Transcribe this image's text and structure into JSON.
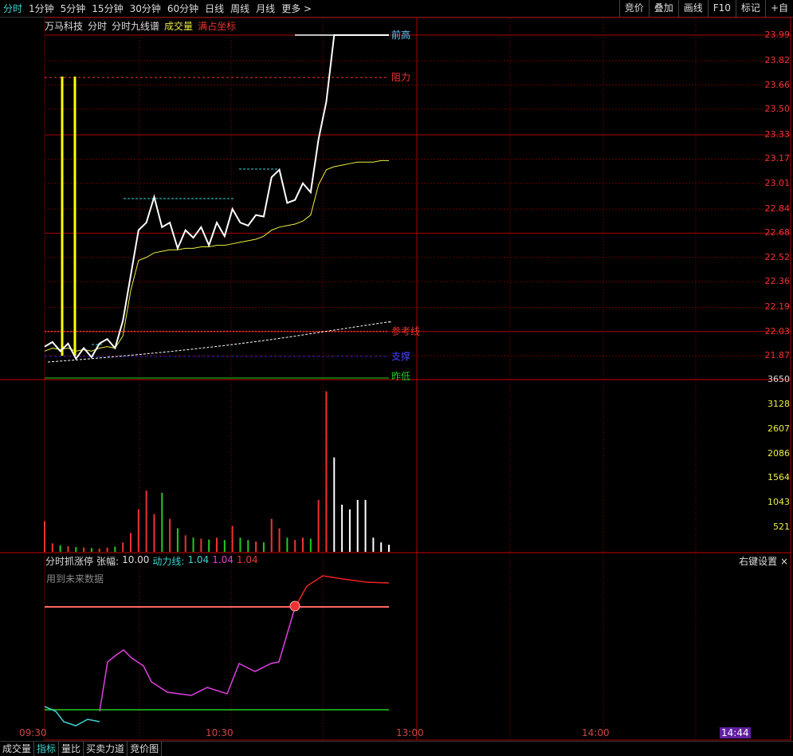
{
  "top_tabs": [
    "分时",
    "1分钟",
    "5分钟",
    "15分钟",
    "30分钟",
    "60分钟",
    "日线",
    "周线",
    "月线",
    "更多 >"
  ],
  "right_buttons": [
    "竞价",
    "叠加",
    "画线",
    "F10",
    "标记",
    "+自"
  ],
  "info": {
    "stock": "万马科技",
    "mode1": "分时",
    "mode2": "分时九线谱",
    "vol": "成交量",
    "coords": "满占坐标"
  },
  "price_ticks": [
    "23.99",
    "23.82",
    "23.66",
    "23.50",
    "23.33",
    "23.17",
    "23.01",
    "22.84",
    "22.68",
    "22.52",
    "22.36",
    "22.19",
    "22.03",
    "21.87"
  ],
  "vol_ticks": [
    "3650",
    "3128",
    "2607",
    "2086",
    "1564",
    "1043",
    "521"
  ],
  "line_labels": {
    "high": "前高",
    "resist": "阻力",
    "ref": "参考线",
    "support": "支撑",
    "low": "昨低"
  },
  "indicator": {
    "name": "分时抓涨停",
    "amp_label": "张幅:",
    "amp": "10.00",
    "dl_label": "动力线:",
    "v1": "1.04",
    "v2": "1.04",
    "v3": "1.04",
    "note": "用到未来数据",
    "settings": "右键设置",
    "close": "×"
  },
  "x_ticks": [
    "09:30",
    "10:30",
    "13:00",
    "14:00",
    "14:44"
  ],
  "bottom_tabs": [
    "成交量",
    "指标",
    "量比",
    "买卖力道",
    "竞价图"
  ],
  "chart_data": {
    "type": "line",
    "price_range": [
      21.87,
      23.99
    ],
    "ref_price": 22.03,
    "price": [
      21.93,
      21.96,
      21.9,
      21.95,
      21.85,
      21.92,
      21.86,
      21.95,
      21.98,
      21.92,
      22.1,
      22.4,
      22.7,
      22.75,
      22.92,
      22.72,
      22.75,
      22.58,
      22.7,
      22.65,
      22.72,
      22.6,
      22.75,
      22.66,
      22.84,
      22.75,
      22.73,
      22.8,
      22.79,
      23.05,
      23.1,
      22.88,
      22.9,
      23.01,
      22.95,
      23.3,
      23.55,
      23.99,
      23.99,
      23.99,
      23.99,
      23.99,
      23.99,
      23.99,
      23.99
    ],
    "avg": [
      21.9,
      21.92,
      21.91,
      21.92,
      21.9,
      21.91,
      21.9,
      21.92,
      21.93,
      21.92,
      22.0,
      22.3,
      22.5,
      22.52,
      22.55,
      22.56,
      22.57,
      22.57,
      22.58,
      22.58,
      22.59,
      22.59,
      22.6,
      22.6,
      22.61,
      22.62,
      22.63,
      22.64,
      22.66,
      22.7,
      22.72,
      22.73,
      22.74,
      22.76,
      22.8,
      23.0,
      23.1,
      23.12,
      23.13,
      23.14,
      23.15,
      23.15,
      23.15,
      23.16,
      23.16
    ],
    "volume": [
      650,
      180,
      140,
      120,
      100,
      90,
      80,
      70,
      90,
      110,
      200,
      400,
      900,
      1300,
      800,
      1250,
      700,
      500,
      350,
      300,
      280,
      260,
      300,
      250,
      550,
      300,
      250,
      220,
      200,
      700,
      500,
      300,
      250,
      300,
      280,
      1100,
      3400,
      2000,
      1000,
      900,
      1100,
      1100,
      300,
      200,
      150
    ]
  }
}
